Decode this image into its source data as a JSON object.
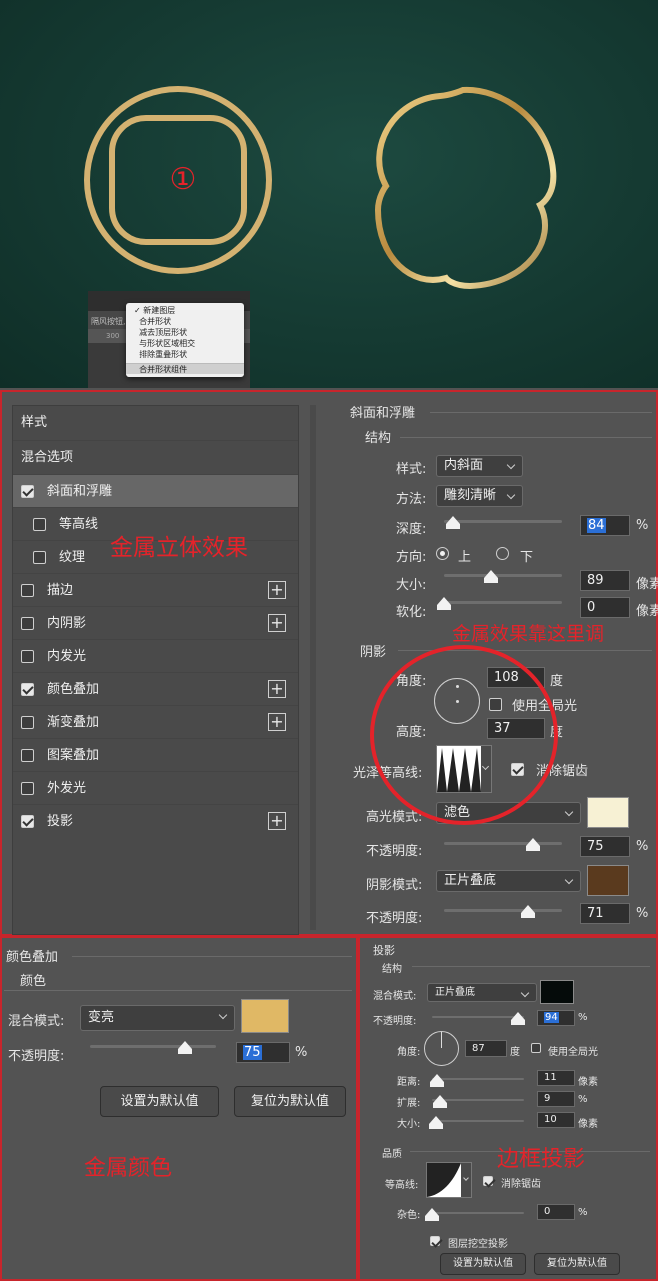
{
  "preview": {
    "marker": "①",
    "mini_ui": {
      "row2_text": "隔风按钮, RC",
      "row3_text": "300",
      "menu_items": [
        "新建图层",
        "合并形状",
        "减去顶层形状",
        "与形状区域相交",
        "排除重叠形状"
      ],
      "menu_bottom": "合并形状组件",
      "checked_index": 0
    }
  },
  "style_list": {
    "title": "样式",
    "blend_options": "混合选项",
    "items": [
      {
        "label": "斜面和浮雕",
        "checked": true,
        "selected": true,
        "plus": false,
        "sub": false
      },
      {
        "label": "等高线",
        "checked": false,
        "plus": false,
        "sub": true
      },
      {
        "label": "纹理",
        "checked": false,
        "plus": false,
        "sub": true
      },
      {
        "label": "描边",
        "checked": false,
        "plus": true,
        "sub": false
      },
      {
        "label": "内阴影",
        "checked": false,
        "plus": true,
        "sub": false
      },
      {
        "label": "内发光",
        "checked": false,
        "plus": false,
        "sub": false
      },
      {
        "label": "颜色叠加",
        "checked": true,
        "plus": true,
        "sub": false
      },
      {
        "label": "渐变叠加",
        "checked": false,
        "plus": true,
        "sub": false
      },
      {
        "label": "图案叠加",
        "checked": false,
        "plus": false,
        "sub": false
      },
      {
        "label": "外发光",
        "checked": false,
        "plus": false,
        "sub": false
      },
      {
        "label": "投影",
        "checked": true,
        "plus": true,
        "sub": false
      }
    ]
  },
  "bevel": {
    "title": "斜面和浮雕",
    "structure": "结构",
    "style_label": "样式:",
    "style_value": "内斜面",
    "method_label": "方法:",
    "method_value": "雕刻清晰",
    "depth_label": "深度:",
    "depth_value": "84",
    "depth_unit": "%",
    "depth_level": 0.08,
    "direction_label": "方向:",
    "dir_up": "上",
    "dir_down": "下",
    "size_label": "大小:",
    "size_value": "89",
    "size_unit": "像素",
    "size_level": 0.4,
    "soften_label": "软化:",
    "soften_value": "0",
    "soften_unit": "像素",
    "soften_level": 0.0,
    "shading": "阴影",
    "angle_label": "角度:",
    "angle_value": "108",
    "angle_unit": "度",
    "global_light": "使用全局光",
    "altitude_label": "高度:",
    "altitude_value": "37",
    "altitude_unit": "度",
    "gloss_label": "光泽等高线:",
    "antialias": "消除锯齿",
    "highlight_label": "高光模式:",
    "highlight_value": "滤色",
    "highlight_color": "#f7f1d4",
    "hl_opacity_label": "不透明度:",
    "hl_opacity_value": "75",
    "hl_opacity_unit": "%",
    "hl_opacity_level": 0.75,
    "shadow_label": "阴影模式:",
    "shadow_value": "正片叠底",
    "shadow_color": "#5a3a1e",
    "sh_opacity_label": "不透明度:",
    "sh_opacity_value": "71",
    "sh_opacity_unit": "%",
    "sh_opacity_level": 0.71
  },
  "color_overlay": {
    "title": "颜色叠加",
    "section": "颜色",
    "blend_label": "混合模式:",
    "blend_value": "变亮",
    "color": "#e0b865",
    "opacity_label": "不透明度:",
    "opacity_value": "75",
    "opacity_unit": "%",
    "opacity_level": 0.75,
    "btn_default": "设置为默认值",
    "btn_reset": "复位为默认值"
  },
  "drop_shadow": {
    "title": "投影",
    "structure": "结构",
    "blend_label": "混合模式:",
    "blend_value": "正片叠底",
    "color": "#050b0a",
    "opacity_label": "不透明度:",
    "opacity_value": "94",
    "opacity_unit": "%",
    "opacity_level": 0.94,
    "angle_label": "角度:",
    "angle_value": "87",
    "angle_unit": "度",
    "global_light": "使用全局光",
    "distance_label": "距离:",
    "distance_value": "11",
    "distance_unit": "像素",
    "distance_level": 0.05,
    "spread_label": "扩展:",
    "spread_value": "9",
    "spread_unit": "%",
    "spread_level": 0.09,
    "size_label": "大小:",
    "size_value": "10",
    "size_unit": "像素",
    "size_level": 0.04,
    "quality": "品质",
    "contour_label": "等高线:",
    "antialias": "消除锯齿",
    "noise_label": "杂色:",
    "noise_value": "0",
    "noise_unit": "%",
    "noise_level": 0.0,
    "knockout": "图层挖空投影",
    "btn_default": "设置为默认值",
    "btn_reset": "复位为默认值"
  },
  "annotations": {
    "metal_3d": "金属立体效果",
    "metal_adjust": "金属效果靠这里调",
    "metal_color": "金属颜色",
    "border_shadow": "边框投影"
  },
  "colors": {
    "annotation_red": "#e4232a",
    "gold": "#c9a366",
    "panel_bg": "#535353"
  }
}
